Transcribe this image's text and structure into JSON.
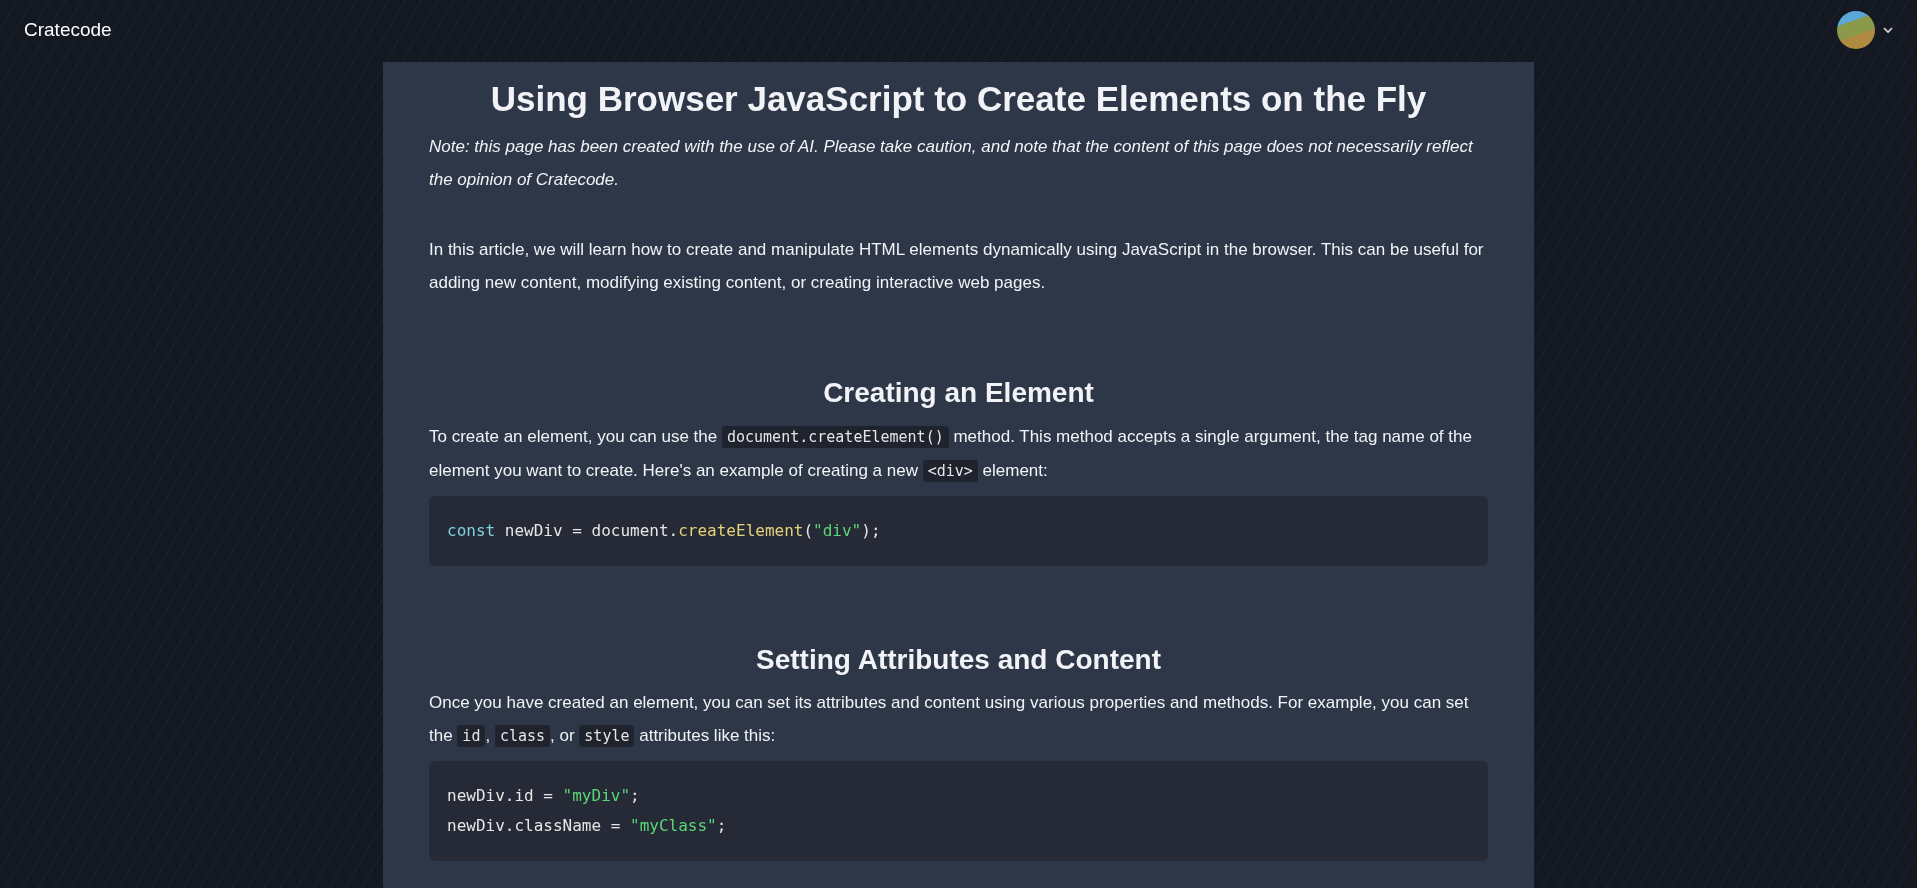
{
  "navbar": {
    "brand": "Cratecode"
  },
  "article": {
    "title": "Using Browser JavaScript to Create Elements on the Fly",
    "note": "Note: this page has been created with the use of AI. Please take caution, and note that the content of this page does not necessarily reflect the opinion of Cratecode.",
    "blocks": [
      {
        "kind": "paragraph",
        "parts": [
          {
            "kind": "text",
            "text": "In this article, we will learn how to create and manipulate HTML elements dynamically using JavaScript in the browser. This can be useful for adding new content, modifying existing content, or creating interactive web pages."
          }
        ]
      },
      {
        "kind": "heading",
        "text": "Creating an Element"
      },
      {
        "kind": "paragraph",
        "parts": [
          {
            "kind": "text",
            "text": "To create an element, you can use the "
          },
          {
            "kind": "code",
            "text": "document.createElement()"
          },
          {
            "kind": "text",
            "text": " method. This method accepts a single argument, the tag name of the element you want to create. Here's an example of creating a new "
          },
          {
            "kind": "code",
            "text": "<div>"
          },
          {
            "kind": "text",
            "text": " element:"
          }
        ]
      },
      {
        "kind": "code",
        "lines": [
          [
            {
              "kind": "keyword",
              "text": "const"
            },
            {
              "kind": "plain",
              "text": " newDiv = document."
            },
            {
              "kind": "function",
              "text": "createElement"
            },
            {
              "kind": "plain",
              "text": "("
            },
            {
              "kind": "string",
              "text": "\"div\""
            },
            {
              "kind": "plain",
              "text": ");"
            }
          ]
        ]
      },
      {
        "kind": "heading",
        "text": "Setting Attributes and Content"
      },
      {
        "kind": "paragraph",
        "parts": [
          {
            "kind": "text",
            "text": "Once you have created an element, you can set its attributes and content using various properties and methods. For example, you can set the "
          },
          {
            "kind": "code",
            "text": "id"
          },
          {
            "kind": "text",
            "text": ", "
          },
          {
            "kind": "code",
            "text": "class"
          },
          {
            "kind": "text",
            "text": ", or "
          },
          {
            "kind": "code",
            "text": "style"
          },
          {
            "kind": "text",
            "text": " attributes like this:"
          }
        ]
      },
      {
        "kind": "code",
        "lines": [
          [
            {
              "kind": "plain",
              "text": "newDiv.id = "
            },
            {
              "kind": "string",
              "text": "\"myDiv\""
            },
            {
              "kind": "plain",
              "text": ";"
            }
          ],
          [
            {
              "kind": "plain",
              "text": "newDiv.className = "
            },
            {
              "kind": "string",
              "text": "\"myClass\""
            },
            {
              "kind": "plain",
              "text": ";"
            }
          ]
        ]
      }
    ]
  }
}
